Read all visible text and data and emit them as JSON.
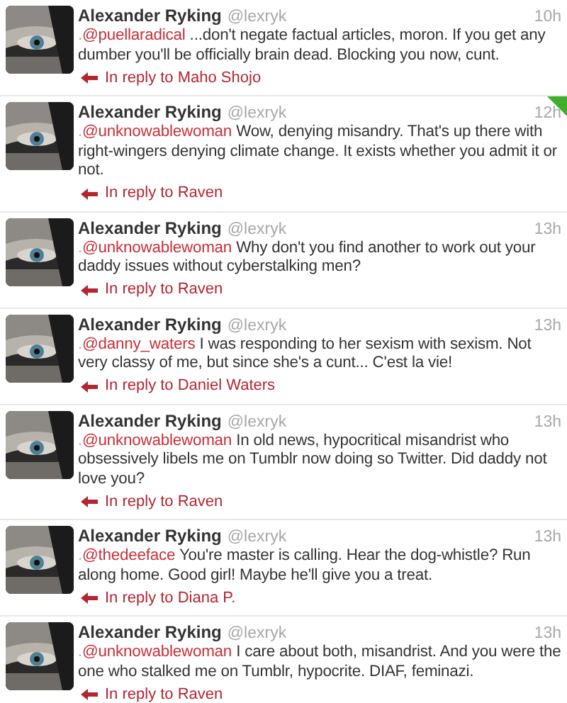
{
  "tweets": [
    {
      "name": "Alexander Ryking",
      "handle": "@lexryk",
      "time": "10h",
      "marked": false,
      "prefix": ".",
      "mention": "@puellaradical",
      "text": " ...don't negate factual articles, moron. If you get any dumber you'll be officially brain dead. Blocking you now, cunt.",
      "reply": "In reply to Maho Shojo"
    },
    {
      "name": "Alexander Ryking",
      "handle": "@lexryk",
      "time": "12h",
      "marked": true,
      "prefix": ".",
      "mention": "@unknowablewoman",
      "text": " Wow, denying misandry. That's up there with right-wingers denying climate change. It exists whether you admit it or not.",
      "reply": "In reply to Raven"
    },
    {
      "name": "Alexander Ryking",
      "handle": "@lexryk",
      "time": "13h",
      "marked": false,
      "prefix": ".",
      "mention": "@unknowablewoman",
      "text": " Why don't you find another to work out your daddy issues without cyberstalking men?",
      "reply": "In reply to Raven"
    },
    {
      "name": "Alexander Ryking",
      "handle": "@lexryk",
      "time": "13h",
      "marked": false,
      "prefix": ".",
      "mention": "@danny_waters",
      "text": " I was responding to her sexism with sexism. Not very classy of me, but since she's a cunt... C'est la vie!",
      "reply": "In reply to Daniel Waters"
    },
    {
      "name": "Alexander Ryking",
      "handle": "@lexryk",
      "time": "13h",
      "marked": false,
      "prefix": ".",
      "mention": "@unknowablewoman",
      "text": " In old news, hypocritical misandrist who obsessively libels me on Tumblr now doing so Twitter. Did daddy not love you?",
      "reply": "In reply to Raven"
    },
    {
      "name": "Alexander Ryking",
      "handle": "@lexryk",
      "time": "13h",
      "marked": false,
      "prefix": ".",
      "mention": "@thedeeface",
      "text": " You're master is calling. Hear the dog-whistle? Run along home. Good girl! Maybe he'll give you a treat.",
      "reply": "In reply to Diana P."
    },
    {
      "name": "Alexander Ryking",
      "handle": "@lexryk",
      "time": "13h",
      "marked": false,
      "prefix": ".",
      "mention": "@unknowablewoman",
      "text": " I care about both, misandrist. And you were the one who stalked me on Tumblr, hypocrite. DIAF, feminazi.",
      "reply": "In reply to Raven"
    }
  ]
}
